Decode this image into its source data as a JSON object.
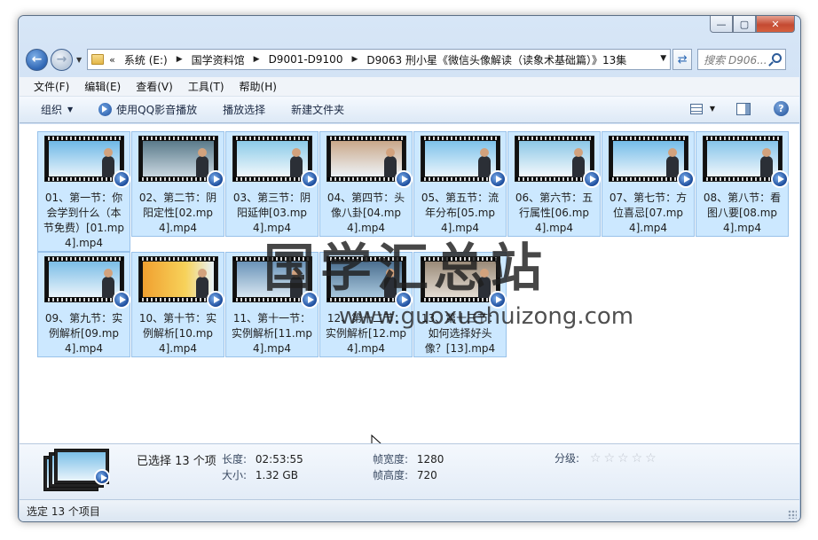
{
  "window": {
    "controls": {
      "minimize": "—",
      "maximize": "▢",
      "close": "✕"
    }
  },
  "address": {
    "chevron": "«",
    "crumbs": [
      "系统 (E:)",
      "国学资料馆",
      "D9001-D9100",
      "D9063 刑小星《微信头像解读（读象术基础篇）》13集"
    ]
  },
  "search": {
    "placeholder": "搜索 D906..."
  },
  "menu": [
    "文件(F)",
    "编辑(E)",
    "查看(V)",
    "工具(T)",
    "帮助(H)"
  ],
  "toolbar": {
    "organize": "组织",
    "play_qq": "使用QQ影音播放",
    "play_selection": "播放选择",
    "new_folder": "新建文件夹"
  },
  "files": [
    {
      "name": "01、第一节：你会学到什么（本节免费）[01.mp4].mp4"
    },
    {
      "name": "02、第二节：阴阳定性[02.mp4].mp4"
    },
    {
      "name": "03、第三节：阴阳延伸[03.mp4].mp4"
    },
    {
      "name": "04、第四节：头像八卦[04.mp4].mp4"
    },
    {
      "name": "05、第五节：流年分布[05.mp4].mp4"
    },
    {
      "name": "06、第六节：五行属性[06.mp4].mp4"
    },
    {
      "name": "07、第七节：方位喜忌[07.mp4].mp4"
    },
    {
      "name": "08、第八节：看图八要[08.mp4].mp4"
    },
    {
      "name": "09、第九节：实例解析[09.mp4].mp4"
    },
    {
      "name": "10、第十节：实例解析[10.mp4].mp4"
    },
    {
      "name": "11、第十一节：实例解析[11.mp4].mp4"
    },
    {
      "name": "12、第十二节：实例解析[12.mp4].mp4"
    },
    {
      "name": "13、第十三节：如何选择好头像？[13].mp4"
    }
  ],
  "watermark": {
    "text": "国学汇总站",
    "url": "www.guoxuehuizong.com"
  },
  "details": {
    "selected": "已选择 13 个项",
    "length_label": "长度:",
    "length": "02:53:55",
    "size_label": "大小:",
    "size": "1.32 GB",
    "width_label": "帧宽度:",
    "width": "1280",
    "height_label": "帧高度:",
    "height": "720",
    "rating_label": "分级:",
    "rating": 0
  },
  "status": {
    "text": "选定 13 个项目"
  }
}
